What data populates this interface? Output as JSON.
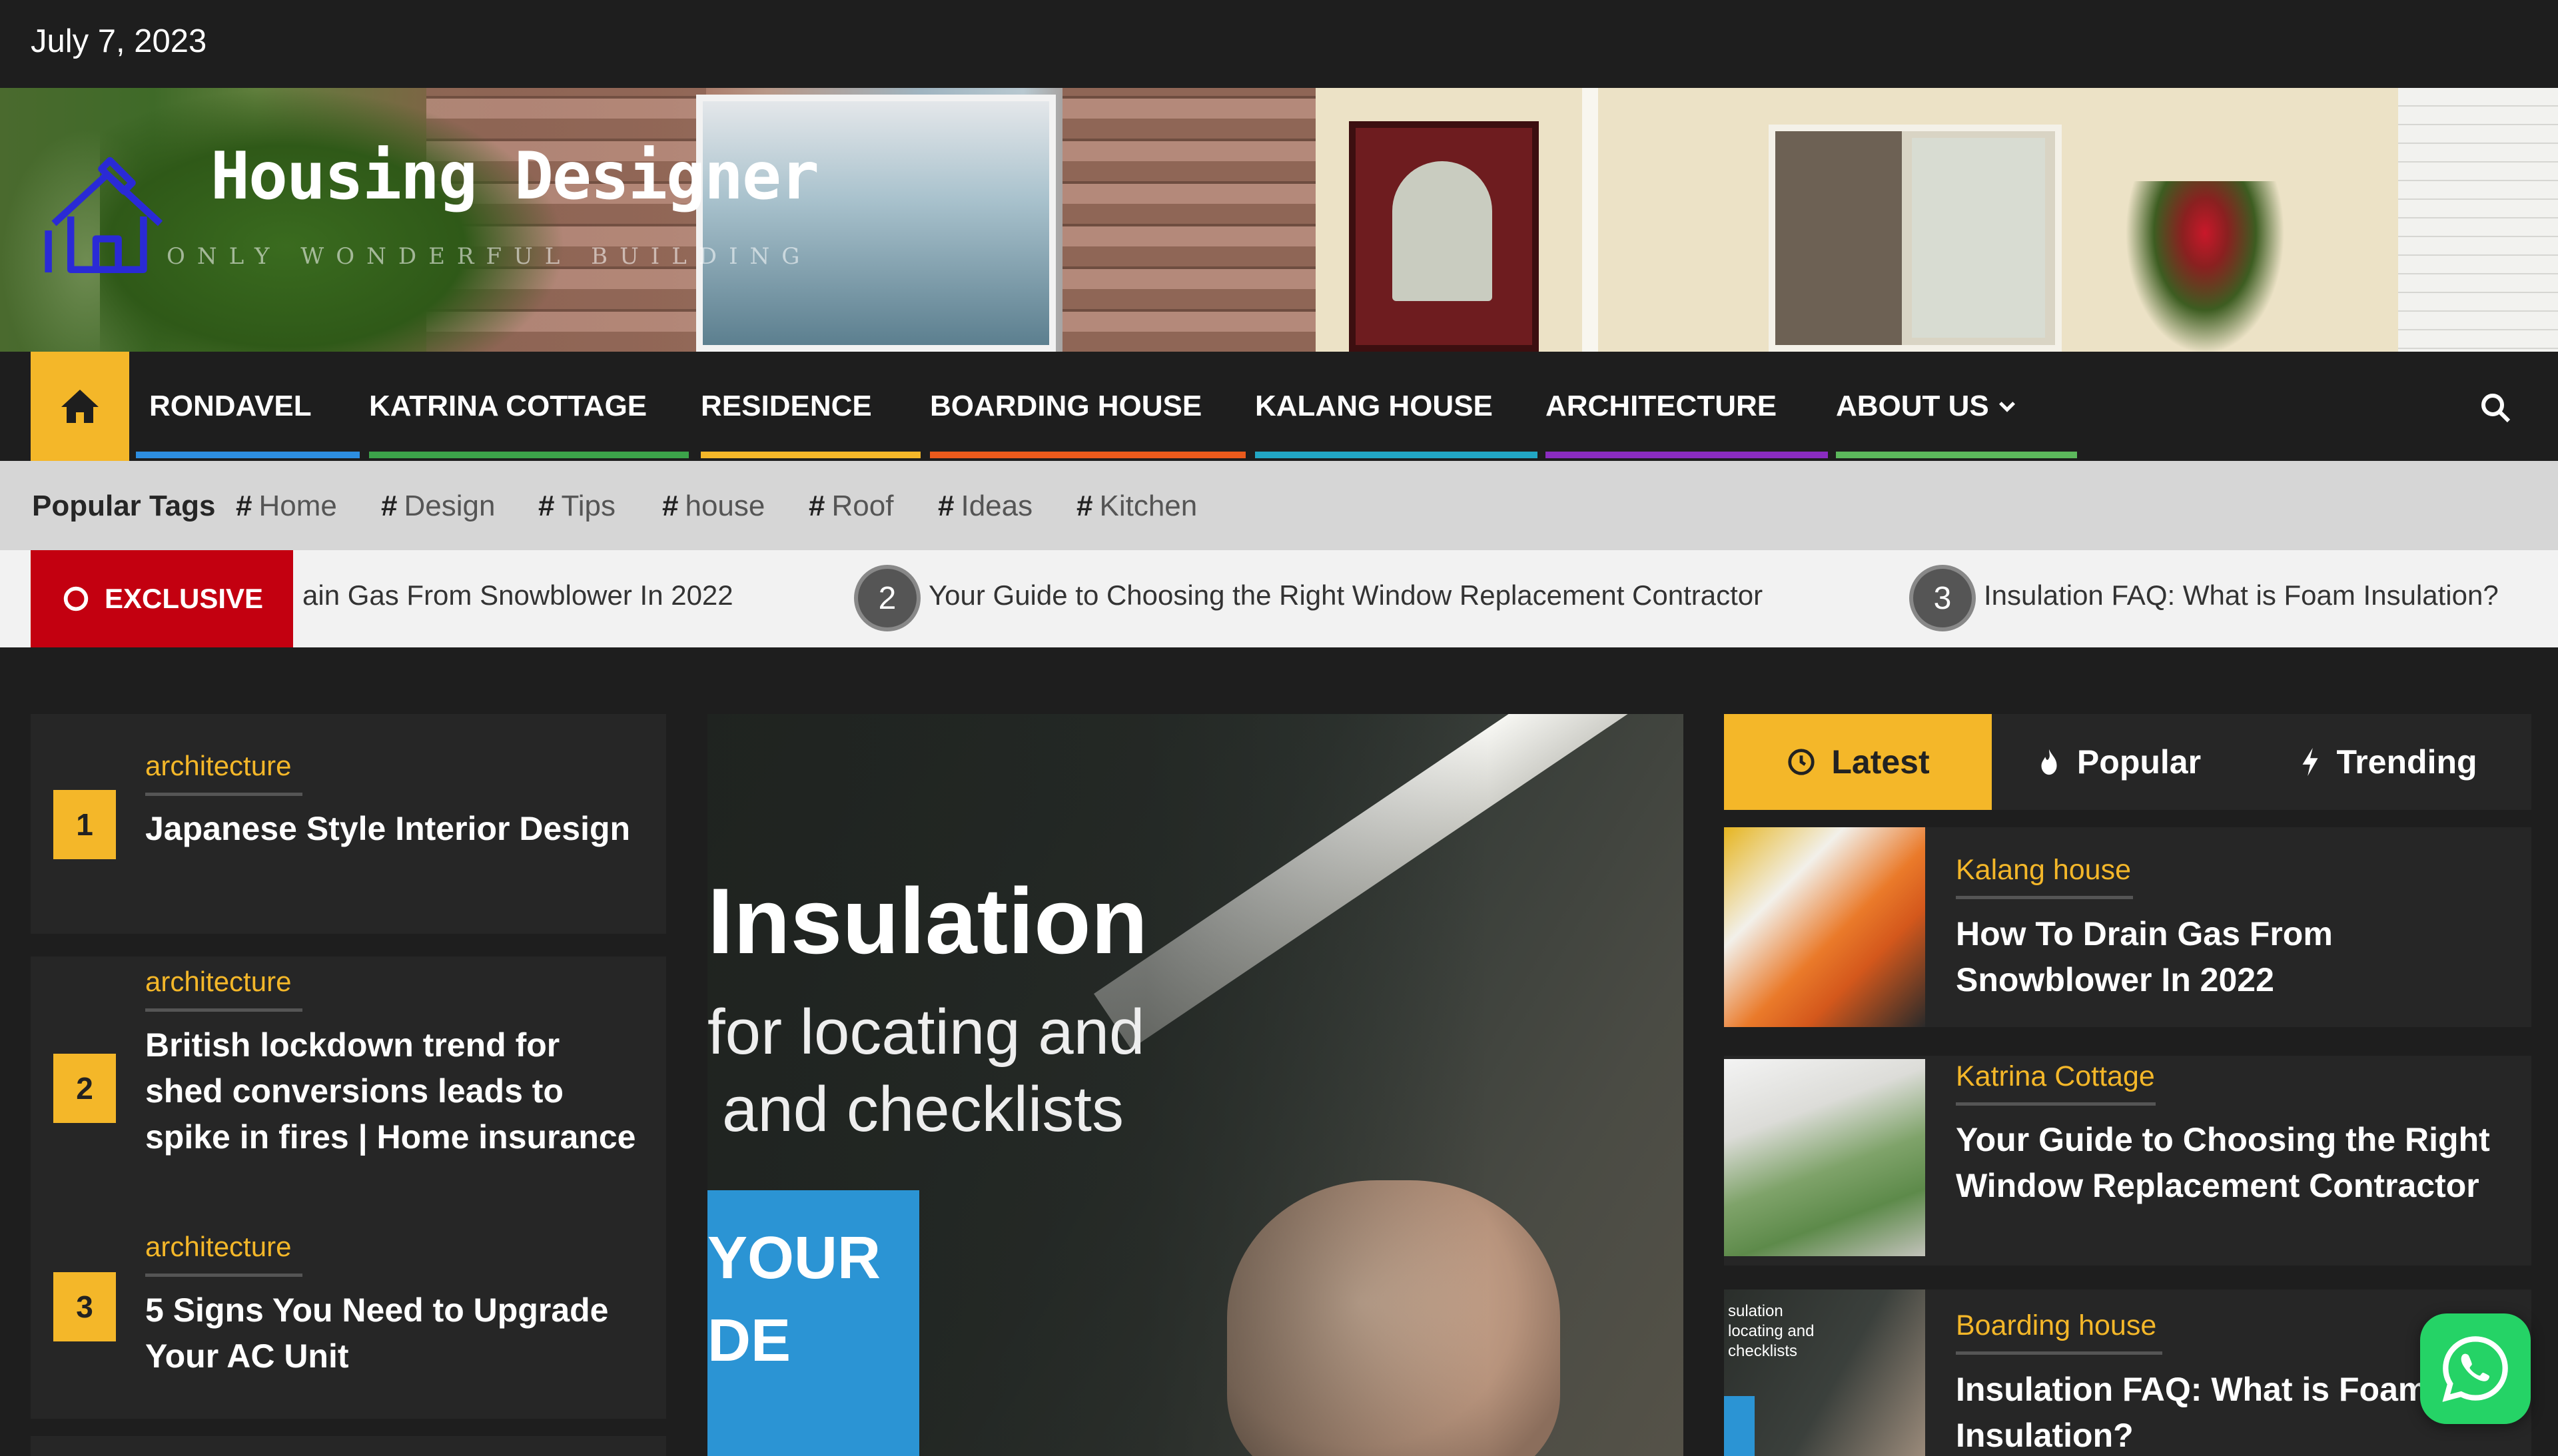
{
  "top_bar": {
    "date": "July 7, 2023"
  },
  "header": {
    "site_title": "Housing Designer",
    "tagline": "ONLY WONDERFUL BUILDING"
  },
  "nav": {
    "home_icon": "home-icon",
    "items": [
      {
        "label": "RONDAVEL",
        "color": "#2d8ee0"
      },
      {
        "label": "KATRINA COTTAGE",
        "color": "#3ca34a"
      },
      {
        "label": "RESIDENCE",
        "color": "#f4b729"
      },
      {
        "label": "BOARDING HOUSE",
        "color": "#ea5a1c"
      },
      {
        "label": "KALANG HOUSE",
        "color": "#22a6c4"
      },
      {
        "label": "ARCHITECTURE",
        "color": "#8a2cc0"
      },
      {
        "label": "ABOUT US",
        "color": "#5cb85c"
      }
    ],
    "search_icon": "search-icon"
  },
  "tags": {
    "label": "Popular Tags",
    "items": [
      "Home",
      "Design",
      "Tips",
      "house",
      "Roof",
      "Ideas",
      "Kitchen"
    ]
  },
  "ticker": {
    "label": "EXCLUSIVE",
    "items": [
      {
        "text": "ain Gas From Snowblower In 2022"
      },
      {
        "num": "2",
        "text": "Your Guide to Choosing the Right Window Replacement Contractor"
      },
      {
        "num": "3",
        "text": "Insulation FAQ: What is Foam Insulation?"
      }
    ]
  },
  "left_list": [
    {
      "num": "1",
      "category": "architecture",
      "title": "Japanese Style Interior Design"
    },
    {
      "num": "2",
      "category": "architecture",
      "title": "British lockdown trend for shed conversions leads to spike in fires | Home insurance"
    },
    {
      "num": "3",
      "category": "architecture",
      "title": "5 Signs You Need to Upgrade Your AC Unit"
    }
  ],
  "slider": {
    "heading": "Insulation",
    "sub_line1": "for locating and",
    "sub_line2": "and checklists",
    "box_line1": "YOUR",
    "box_line2": "DE"
  },
  "tabs": [
    {
      "label": "Latest",
      "icon": "clock-icon",
      "active": true
    },
    {
      "label": "Popular",
      "icon": "fire-icon",
      "active": false
    },
    {
      "label": "Trending",
      "icon": "bolt-icon",
      "active": false
    }
  ],
  "latest_posts": [
    {
      "category": "Kalang house",
      "title": "How To Drain Gas From Snowblower In 2022"
    },
    {
      "category": "Katrina Cottage",
      "title": "Your Guide to Choosing the Right Window Replacement Contractor"
    },
    {
      "category": "Boarding house",
      "title": "Insulation FAQ: What is Foam Insulation?"
    }
  ],
  "thumb3_text": "sulation\nlocating and\nchecklists",
  "whatsapp_icon": "whatsapp-icon"
}
